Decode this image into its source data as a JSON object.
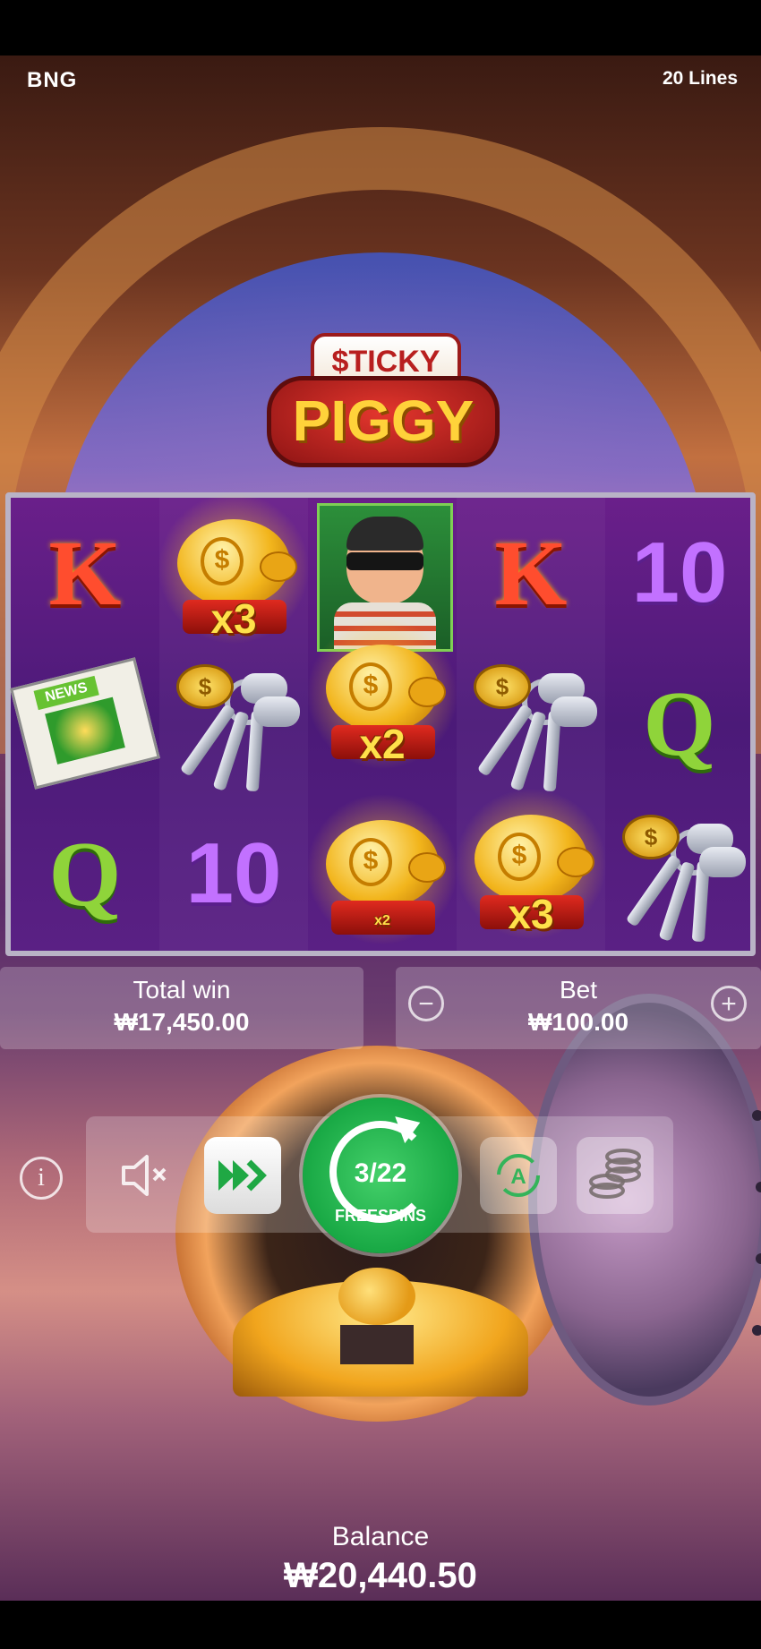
{
  "header": {
    "brand": "BNG",
    "lines": "20 Lines"
  },
  "logo": {
    "line1": "$TICKY",
    "line2": "PIGGY"
  },
  "reels": {
    "columns": [
      [
        {
          "type": "letter",
          "text": "K"
        },
        {
          "type": "newspaper",
          "text": "NEWS"
        },
        {
          "type": "letter",
          "text": "Q"
        }
      ],
      [
        {
          "type": "piggy",
          "mult": "x3"
        },
        {
          "type": "keys",
          "text": "$"
        },
        {
          "type": "letter",
          "text": "10"
        }
      ],
      [
        {
          "type": "robber"
        },
        {
          "type": "piggy",
          "mult": "x2"
        },
        {
          "type": "piggy",
          "mult": "x2"
        }
      ],
      [
        {
          "type": "letter",
          "text": "K"
        },
        {
          "type": "keys",
          "text": "$"
        },
        {
          "type": "piggy",
          "mult": "x3"
        }
      ],
      [
        {
          "type": "letter",
          "text": "10"
        },
        {
          "type": "letter",
          "text": "Q"
        },
        {
          "type": "keys",
          "text": "$"
        }
      ]
    ]
  },
  "win": {
    "label": "Total win",
    "value": "₩17,450.00"
  },
  "bet": {
    "label": "Bet",
    "value": "₩100.00",
    "minus": "−",
    "plus": "+"
  },
  "controls": {
    "info": "i",
    "freespins_count": "3/22",
    "freespins_label": "FREESPINS",
    "auto_glyph": "A"
  },
  "balance": {
    "label": "Balance",
    "value": "₩20,440.50"
  },
  "colors": {
    "spin_green": "#18a844",
    "panel": "rgba(255,255,255,0.22)"
  }
}
